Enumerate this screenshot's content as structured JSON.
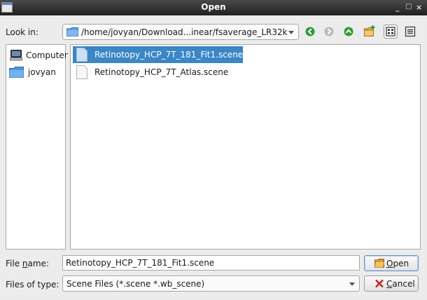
{
  "window": {
    "title": "Open",
    "minimize": "_",
    "maximize": "□",
    "close": "×"
  },
  "lookin": {
    "label": "Look in:",
    "path": "/home/jovyan/Download...inear/fsaverage_LR32k"
  },
  "toolbar": {
    "icons": [
      "back-icon",
      "forward-icon",
      "parent-directory-icon",
      "new-folder-icon",
      "list-view-icon",
      "detail-view-icon"
    ]
  },
  "sidebar": {
    "items": [
      {
        "label": "Computer",
        "icon": "computer-icon"
      },
      {
        "label": "jovyan",
        "icon": "folder-icon"
      }
    ]
  },
  "files": [
    {
      "name": "Retinotopy_HCP_7T_181_Fit1.scene",
      "selected": true
    },
    {
      "name": "Retinotopy_HCP_7T_Atlas.scene",
      "selected": false
    }
  ],
  "filename": {
    "label_pre": "File ",
    "label_u": "n",
    "label_post": "ame:",
    "value": "Retinotopy_HCP_7T_181_Fit1.scene"
  },
  "filetype": {
    "label": "Files of type:",
    "value": "Scene Files (*.scene *.wb_scene)"
  },
  "buttons": {
    "open": {
      "u": "O",
      "rest": "pen"
    },
    "cancel": {
      "u": "C",
      "rest": "ancel"
    }
  },
  "colors": {
    "selection": "#3a86c6",
    "toolbar_green": "#2e9a3a",
    "titlebar": "#2a2a2a"
  }
}
